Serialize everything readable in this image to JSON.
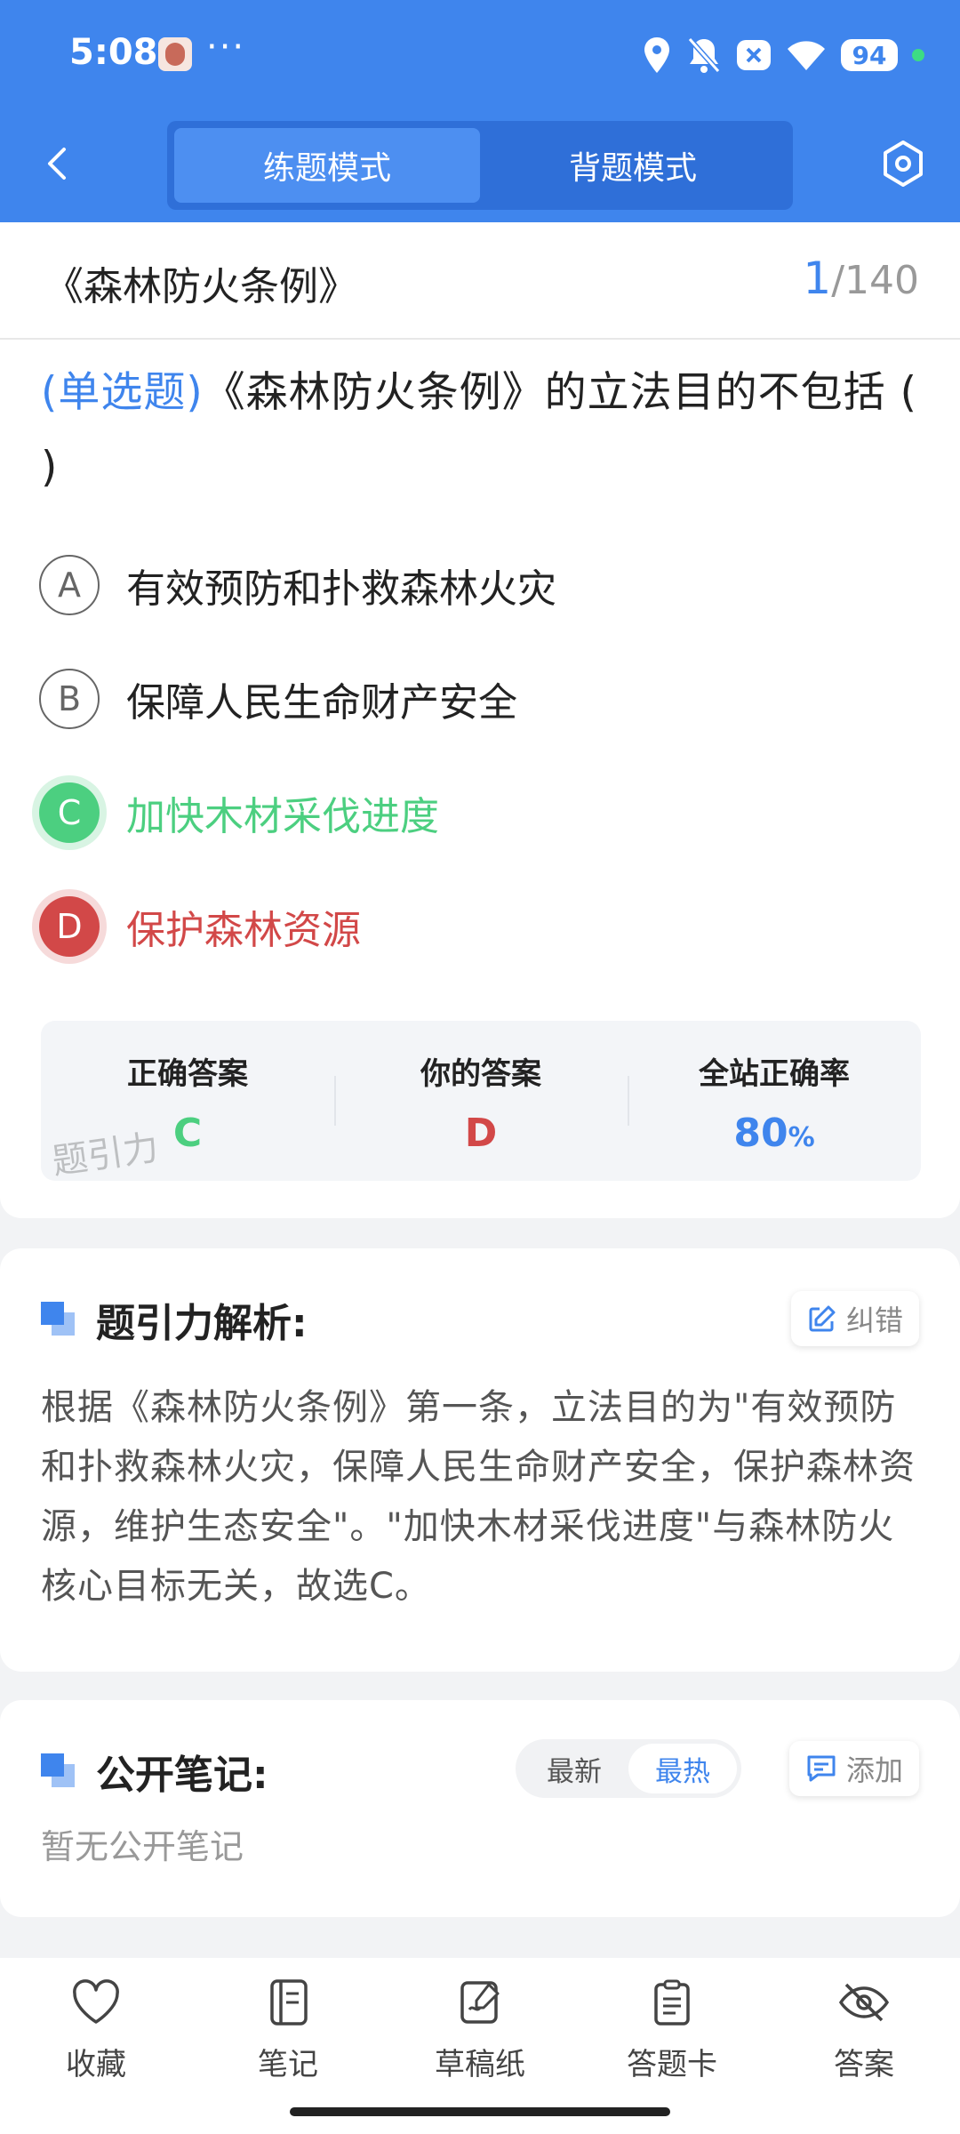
{
  "status_bar": {
    "time": "5:08",
    "dots": "···",
    "battery": "94"
  },
  "nav": {
    "modes": [
      {
        "label": "练题模式",
        "active": true
      },
      {
        "label": "背题模式",
        "active": false
      }
    ]
  },
  "question_card": {
    "book_title": "《森林防火条例》",
    "counter": {
      "current": "1",
      "total": "/140"
    },
    "type_tag": "(单选题)",
    "stem": "《森林防火条例》的立法目的不包括 (       )",
    "options": [
      {
        "letter": "A",
        "text": "有效预防和扑救森林火灾",
        "state": "normal"
      },
      {
        "letter": "B",
        "text": "保障人民生命财产安全",
        "state": "normal"
      },
      {
        "letter": "C",
        "text": "加快木材采伐进度",
        "state": "correct"
      },
      {
        "letter": "D",
        "text": "保护森林资源",
        "state": "wrong"
      }
    ],
    "result": {
      "correct_label": "正确答案",
      "correct_value": "C",
      "yours_label": "你的答案",
      "yours_value": "D",
      "rate_label": "全站正确率",
      "rate_value": "80",
      "rate_unit": "%",
      "watermark": "题引力"
    }
  },
  "analysis": {
    "title": "题引力解析:",
    "report_label": "纠错",
    "text": "根据《森林防火条例》第一条，立法目的为\"有效预防和扑救森林火灾，保障人民生命财产安全，保护森林资源，维护生态安全\"。\"加快木材采伐进度\"与森林防火核心目标无关，故选C。"
  },
  "notes": {
    "title": "公开笔记:",
    "sort_options": [
      {
        "label": "最新",
        "active": false
      },
      {
        "label": "最热",
        "active": true
      }
    ],
    "add_label": "添加",
    "empty": "暂无公开笔记"
  },
  "tabbar": {
    "items": [
      {
        "label": "收藏",
        "icon": "heart-icon"
      },
      {
        "label": "笔记",
        "icon": "notebook-icon"
      },
      {
        "label": "草稿纸",
        "icon": "draft-icon"
      },
      {
        "label": "答题卡",
        "icon": "clipboard-icon"
      },
      {
        "label": "答案",
        "icon": "eye-off-icon"
      }
    ]
  },
  "colors": {
    "primary": "#3f85ed",
    "correct": "#4ccf80",
    "wrong": "#d24848"
  }
}
